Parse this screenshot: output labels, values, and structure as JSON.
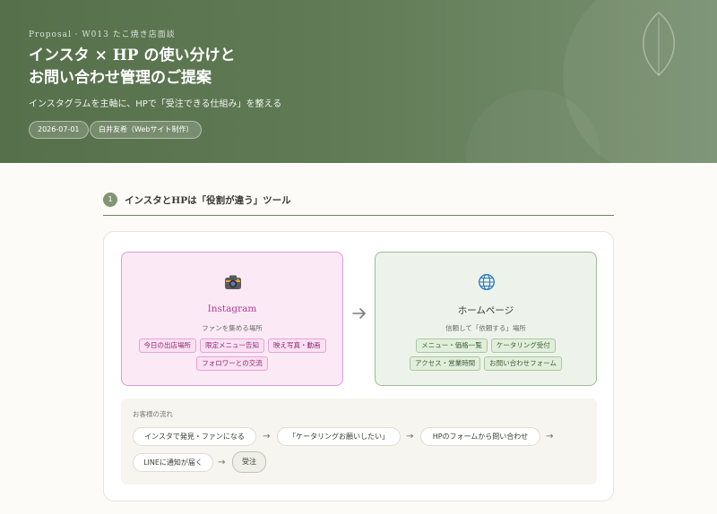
{
  "header": {
    "eyebrow": "Proposal · W013 たこ焼き店面談",
    "title_line1": "インスタ × HP の使い分けと",
    "title_line2": "お問い合わせ管理のご提案",
    "subtitle": "インスタグラムを主軸に、HPで「受注できる仕組み」を整える",
    "date": "2026-07-01",
    "author": "白井友希（Webサイト制作）"
  },
  "section": {
    "number": "1",
    "title": "インスタとHPは「役割が違う」ツール"
  },
  "tools": {
    "instagram": {
      "icon": "camera-icon",
      "name": "Instagram",
      "description": "ファンを集める場所",
      "tags": [
        "今日の出店場所",
        "限定メニュー告知",
        "映え写真・動画",
        "フォロワーとの交流"
      ]
    },
    "homepage": {
      "icon": "globe-icon",
      "name": "ホームページ",
      "description": "信頼して「依頼する」場所",
      "tags": [
        "メニュー・価格一覧",
        "ケータリング受付",
        "アクセス・営業時間",
        "お問い合わせフォーム"
      ]
    }
  },
  "flow": {
    "label": "お客様の流れ",
    "steps": [
      "インスタで発見・ファンになる",
      "「ケータリングお願いしたい」",
      "HPのフォームから問い合わせ",
      "LINEに通知が届く",
      "受注"
    ],
    "arrow": "→"
  },
  "colors": {
    "header_green": "#5f7854",
    "instagram_pink": "#b83a97",
    "homepage_green": "#9cbd93"
  }
}
